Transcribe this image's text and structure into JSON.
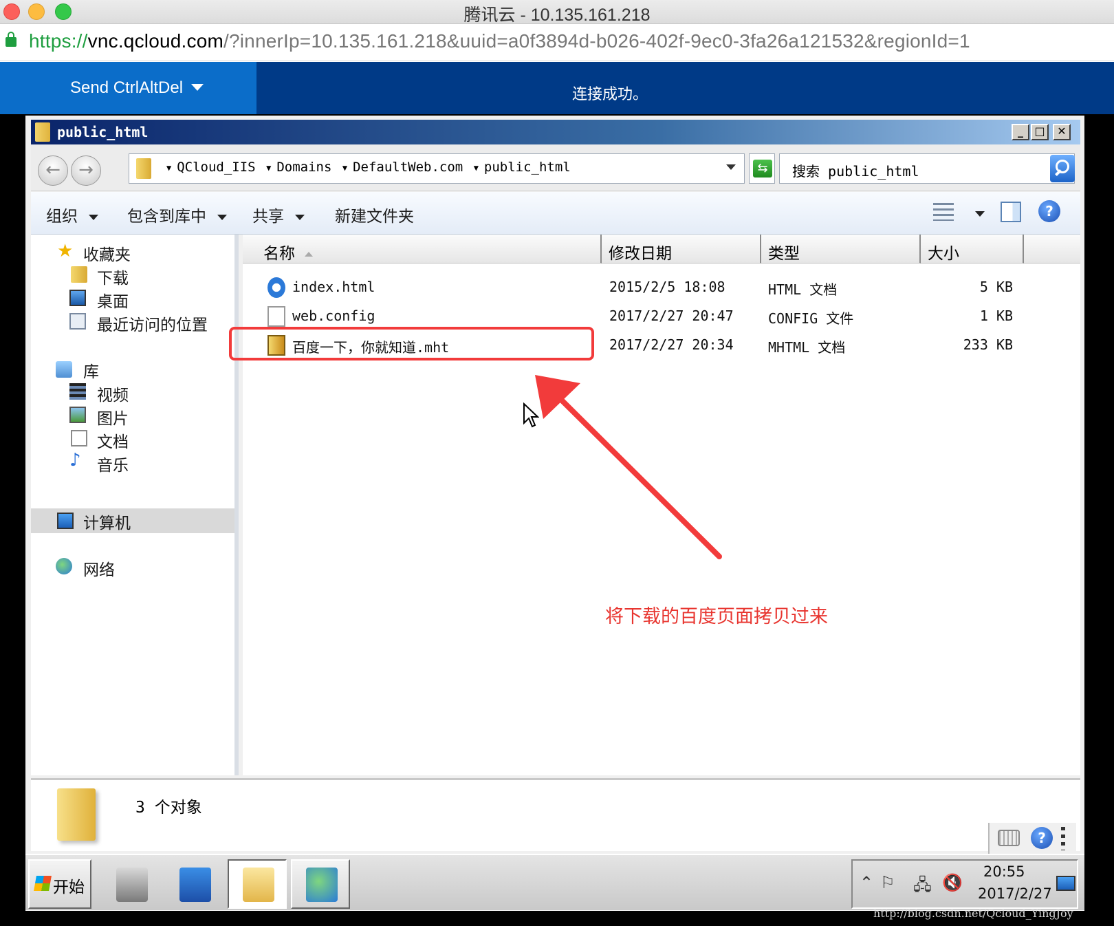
{
  "browser": {
    "window_title": "腾讯云 - 10.135.161.218",
    "url_scheme": "https://",
    "url_host": "vnc.qcloud.com",
    "url_rest": "/?innerIp=10.135.161.218&uuid=a0f3894d-b026-402f-9ec0-3fa26a121532&regionId=1"
  },
  "vnc": {
    "send_label": "Send CtrlAltDel",
    "status": "连接成功。"
  },
  "explorer": {
    "title": "public_html",
    "breadcrumbs": [
      "QCloud_IIS",
      "Domains",
      "DefaultWeb.com",
      "public_html"
    ],
    "search_placeholder": "搜索 public_html",
    "commands": {
      "organize": "组织",
      "include_library": "包含到库中",
      "share": "共享",
      "new_folder": "新建文件夹"
    },
    "nav": {
      "favorites": "收藏夹",
      "downloads": "下载",
      "desktop": "桌面",
      "recent": "最近访问的位置",
      "libraries": "库",
      "videos": "视频",
      "pictures": "图片",
      "documents": "文档",
      "music": "音乐",
      "computer": "计算机",
      "network": "网络"
    },
    "columns": {
      "name": "名称",
      "date": "修改日期",
      "type": "类型",
      "size": "大小"
    },
    "files": [
      {
        "name": "index.html",
        "date": "2015/2/5 18:08",
        "type": "HTML 文档",
        "size": "5 KB",
        "icon": "ie-html-icon"
      },
      {
        "name": "web.config",
        "date": "2017/2/27 20:47",
        "type": "CONFIG 文件",
        "size": "1 KB",
        "icon": "blank-file-icon"
      },
      {
        "name": "百度一下，你就知道.mht",
        "date": "2017/2/27 20:34",
        "type": "MHTML 文档",
        "size": "233 KB",
        "icon": "mht-file-icon"
      }
    ],
    "status_count": "3 个对象"
  },
  "annotation": {
    "note": "将下载的百度页面拷贝过来",
    "color": "#e8352f"
  },
  "taskbar": {
    "start_label": "开始",
    "clock_time": "20:55",
    "clock_date": "2017/2/27"
  },
  "watermark": "http://blog.csdn.net/Qcloud_YingJoy"
}
